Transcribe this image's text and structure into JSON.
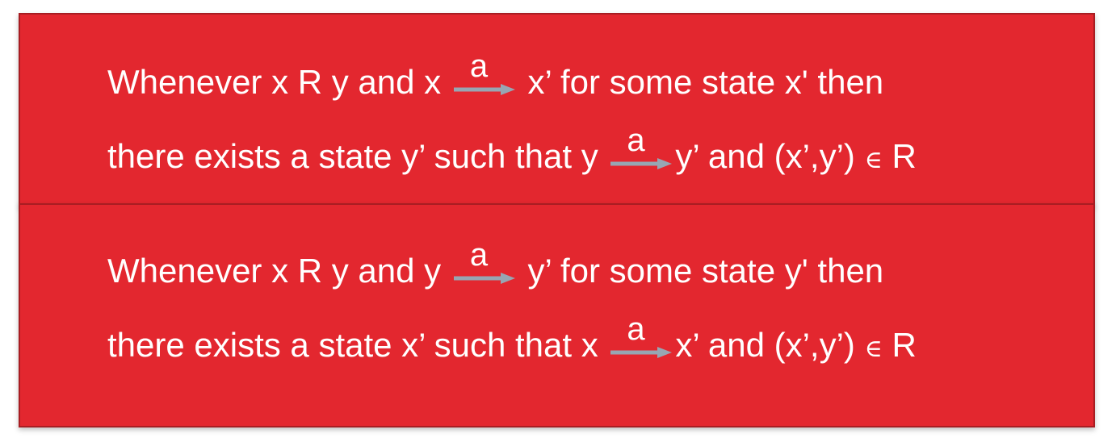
{
  "colors": {
    "box_fill": "#e3272f",
    "box_border": "#a81d22",
    "text": "#ffffff",
    "arrow": "#97a6b3"
  },
  "top_box": {
    "line1": {
      "prefix": "Whenever x R y and x ",
      "label": "a",
      "suffix": " x’  for some state x' then"
    },
    "line2": {
      "prefix": "there exists a state y’ such that y ",
      "label": "a",
      "suffix": "y’ and (x’,y’) ",
      "element_of": "∈",
      "relation": " R"
    }
  },
  "bottom_box": {
    "line1": {
      "prefix": "Whenever x R y and y ",
      "label": "a",
      "suffix": " y’  for some state y' then"
    },
    "line2": {
      "prefix": "there exists a state x’ such that x ",
      "label": "a",
      "suffix": "x’ and (x’,y’) ",
      "element_of": "∈",
      "relation": " R"
    }
  }
}
